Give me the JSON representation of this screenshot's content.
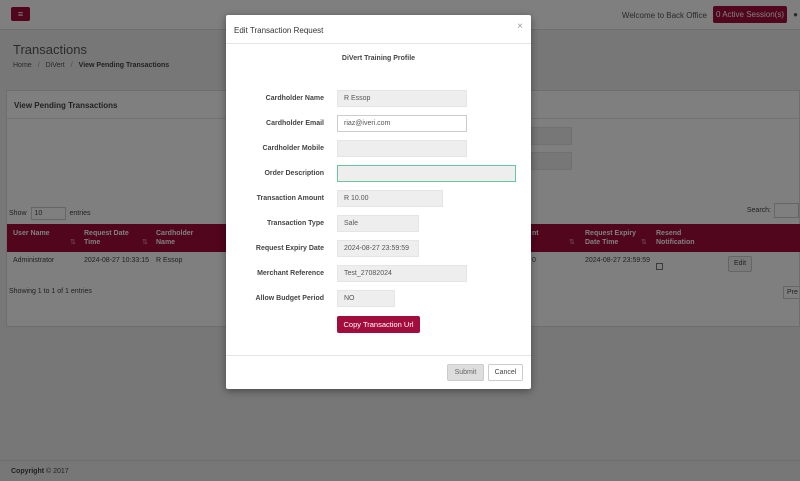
{
  "topbar": {
    "menu_glyph": "≡",
    "welcome": "Welcome to Back Office",
    "sessions_label": "0 Active Session(s)"
  },
  "page": {
    "title": "Transactions",
    "breadcrumb": [
      "Home",
      "DiVert",
      "View Pending Transactions"
    ]
  },
  "panel": {
    "title": "View Pending Transactions",
    "show_label": "Show",
    "show_value": "10",
    "entries_label": "entries",
    "search_label": "Search:",
    "columns": [
      "User Name",
      "Request Date Time",
      "Cardholder Name",
      "nt",
      "Request Expiry Date Time",
      "Resend Notification"
    ],
    "row": {
      "user_name": "Administrator",
      "request_date": "2024-08-27 10:33:15",
      "cardholder": "R Essop",
      "amount_partial": "0",
      "expiry": "2024-08-27 23:59:59",
      "edit_label": "Edit"
    },
    "info": "Showing 1 to 1 of 1 entries",
    "prev_label": "Pre"
  },
  "footer": {
    "copyright_label": "Copyright",
    "copyright_rest": "© 2017"
  },
  "modal": {
    "title": "Edit Transaction Request",
    "close_glyph": "×",
    "profile": "DiVert Training Profile",
    "fields": [
      {
        "label": "Cardholder Name",
        "value": "R Essop"
      },
      {
        "label": "Cardholder Email",
        "value": "riaz@iveri.com"
      },
      {
        "label": "Cardholder Mobile",
        "value": ""
      },
      {
        "label": "Order Description",
        "value": ""
      },
      {
        "label": "Transaction Amount",
        "value": "R 10.00"
      },
      {
        "label": "Transaction Type",
        "value": "Sale"
      },
      {
        "label": "Request Expiry Date",
        "value": "2024-08-27 23:59:59"
      },
      {
        "label": "Merchant Reference",
        "value": "Test_27082024"
      },
      {
        "label": "Allow Budget Period",
        "value": "NO"
      }
    ],
    "copy_label": "Copy Transaction Url",
    "submit_label": "Submit",
    "cancel_label": "Cancel"
  },
  "colors": {
    "brand": "#a30d3d",
    "focus_border": "#66c7a0"
  }
}
